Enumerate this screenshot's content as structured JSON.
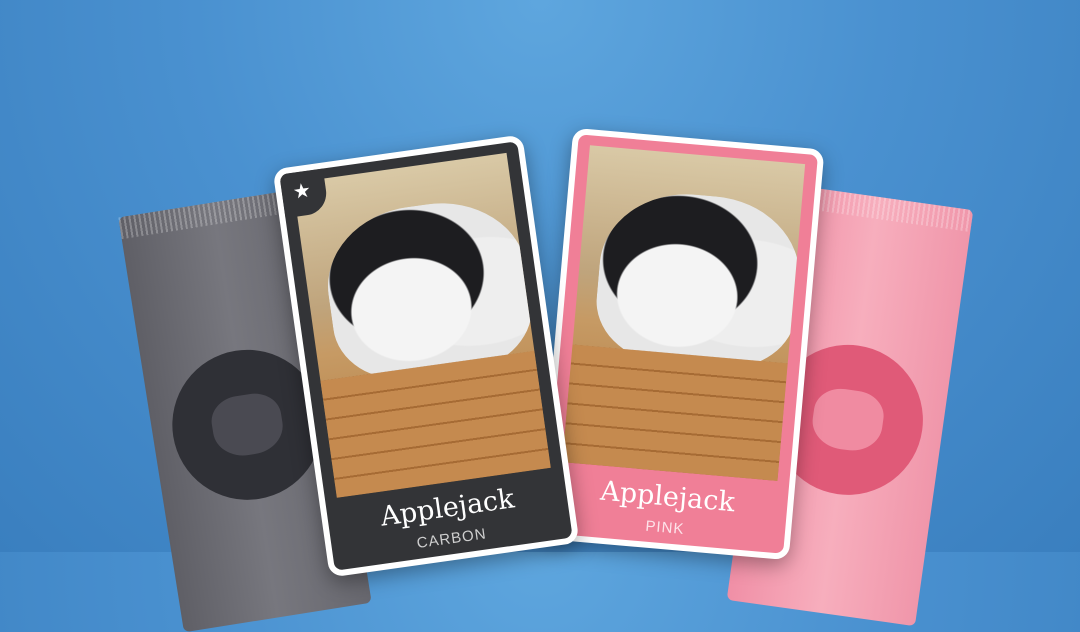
{
  "cards": [
    {
      "title": "Applejack",
      "variant": "CARBON",
      "color": "#333437",
      "favorite": true
    },
    {
      "title": "Applejack",
      "variant": "PINK",
      "color": "#f07f97",
      "favorite": false
    }
  ],
  "packs": [
    {
      "name": "gray-pack",
      "color": "#6b6b72"
    },
    {
      "name": "pink-pack",
      "color": "#f4a2b4"
    }
  ],
  "icons": {
    "star": "★"
  }
}
